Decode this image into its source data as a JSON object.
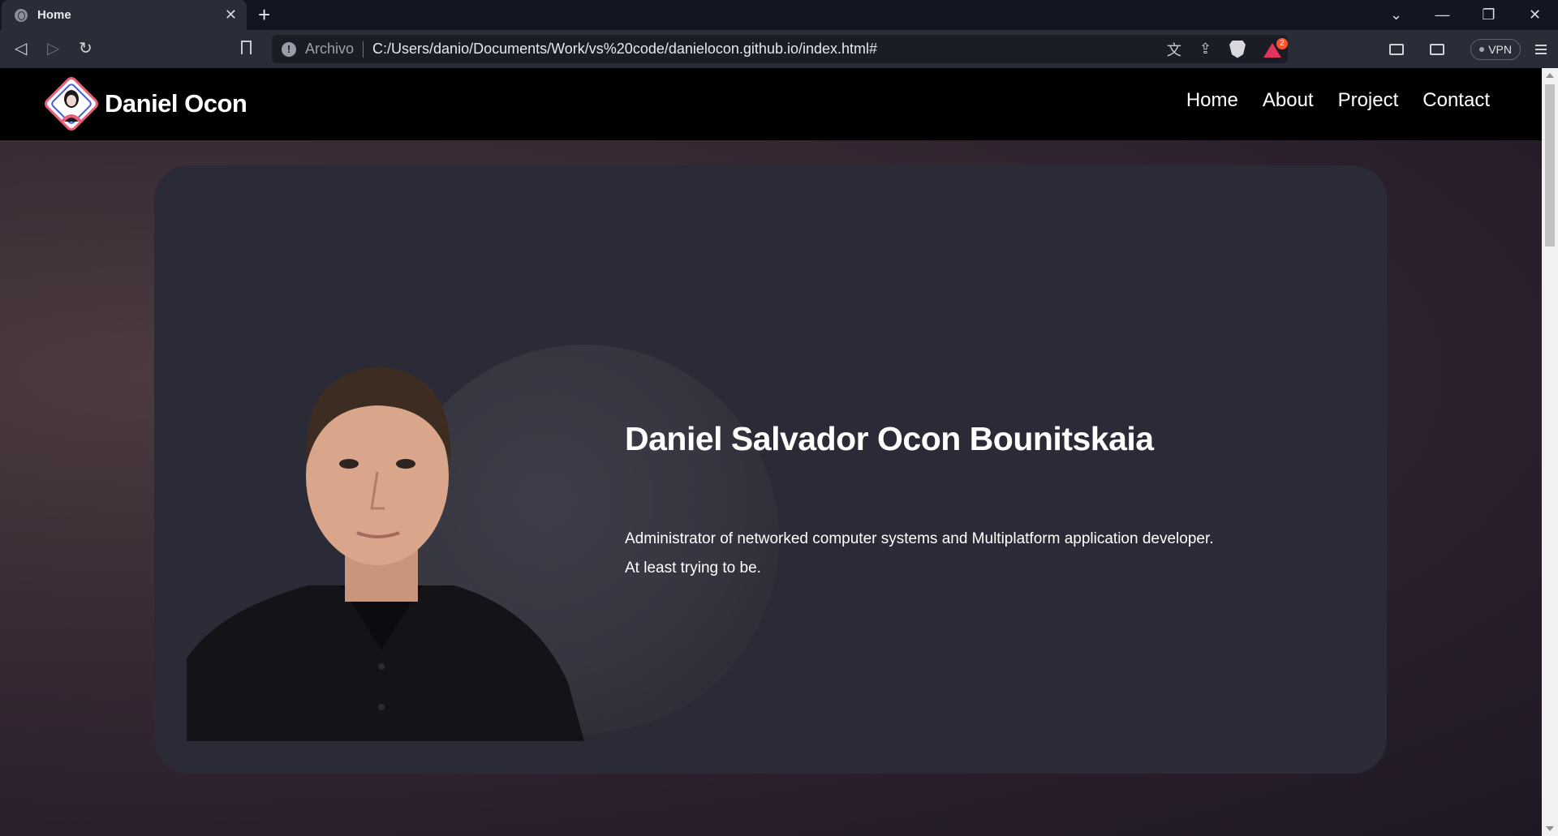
{
  "browser": {
    "tab_title": "Home",
    "tab_close": "✕",
    "new_tab": "+",
    "scheme_label": "Archivo",
    "url": "C:/Users/danio/Documents/Work/vs%20code/danielocon.github.io/index.html#",
    "rewards_badge": "2",
    "vpn_label": "VPN",
    "window_controls": [
      "⌄",
      "—",
      "❐",
      "✕"
    ],
    "nav_icons": {
      "back": "◁",
      "forward": "▷",
      "reload": "↻"
    },
    "icons": [
      "tab-favicon-icon",
      "back-icon",
      "forward-icon",
      "reload-icon",
      "bookmark-icon",
      "info-icon",
      "translate-icon",
      "share-icon",
      "brave-shield-icon",
      "brave-rewards-icon",
      "sidebar-icon",
      "wallet-icon",
      "menu-icon"
    ]
  },
  "site": {
    "title": "Daniel Ocon",
    "nav": [
      "Home",
      "About",
      "Project",
      "Contact"
    ]
  },
  "hero": {
    "name": "Daniel Salvador Ocon Bounitskaia",
    "desc_line1": "Administrator of networked computer systems and Multiplatform application developer.",
    "desc_line2": "At least trying to be."
  },
  "colors": {
    "card_bg": "#2b2b37",
    "header_bg": "#000000",
    "logo_accent": "#e8607a",
    "logo_blue": "#4a5bd6"
  }
}
